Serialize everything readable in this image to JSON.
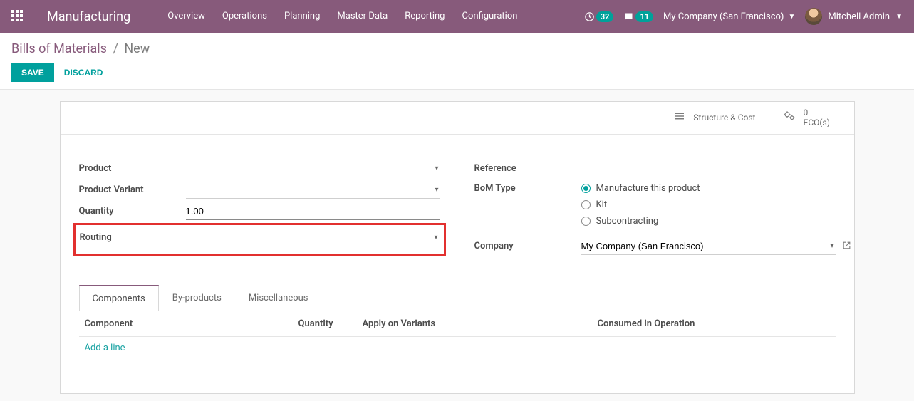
{
  "header": {
    "brand": "Manufacturing",
    "nav": [
      "Overview",
      "Operations",
      "Planning",
      "Master Data",
      "Reporting",
      "Configuration"
    ],
    "activity_badge": "32",
    "messages_badge": "11",
    "company": "My Company (San Francisco)",
    "user": "Mitchell Admin"
  },
  "breadcrumb": {
    "root": "Bills of Materials",
    "current": "New"
  },
  "actions": {
    "save": "SAVE",
    "discard": "DISCARD"
  },
  "stat_buttons": {
    "structure": "Structure & Cost",
    "eco_count": "0",
    "eco_label": "ECO(s)"
  },
  "form": {
    "labels": {
      "product": "Product",
      "product_variant": "Product Variant",
      "quantity": "Quantity",
      "routing": "Routing",
      "reference": "Reference",
      "bom_type": "BoM Type",
      "company": "Company"
    },
    "values": {
      "quantity": "1.00",
      "company": "My Company (San Francisco)"
    },
    "bom_type_options": {
      "manufacture": "Manufacture this product",
      "kit": "Kit",
      "subcontracting": "Subcontracting"
    }
  },
  "tabs": {
    "components": "Components",
    "byproducts": "By-products",
    "misc": "Miscellaneous"
  },
  "table": {
    "headers": {
      "component": "Component",
      "quantity": "Quantity",
      "variants": "Apply on Variants",
      "consumed": "Consumed in Operation"
    },
    "add_line": "Add a line"
  }
}
